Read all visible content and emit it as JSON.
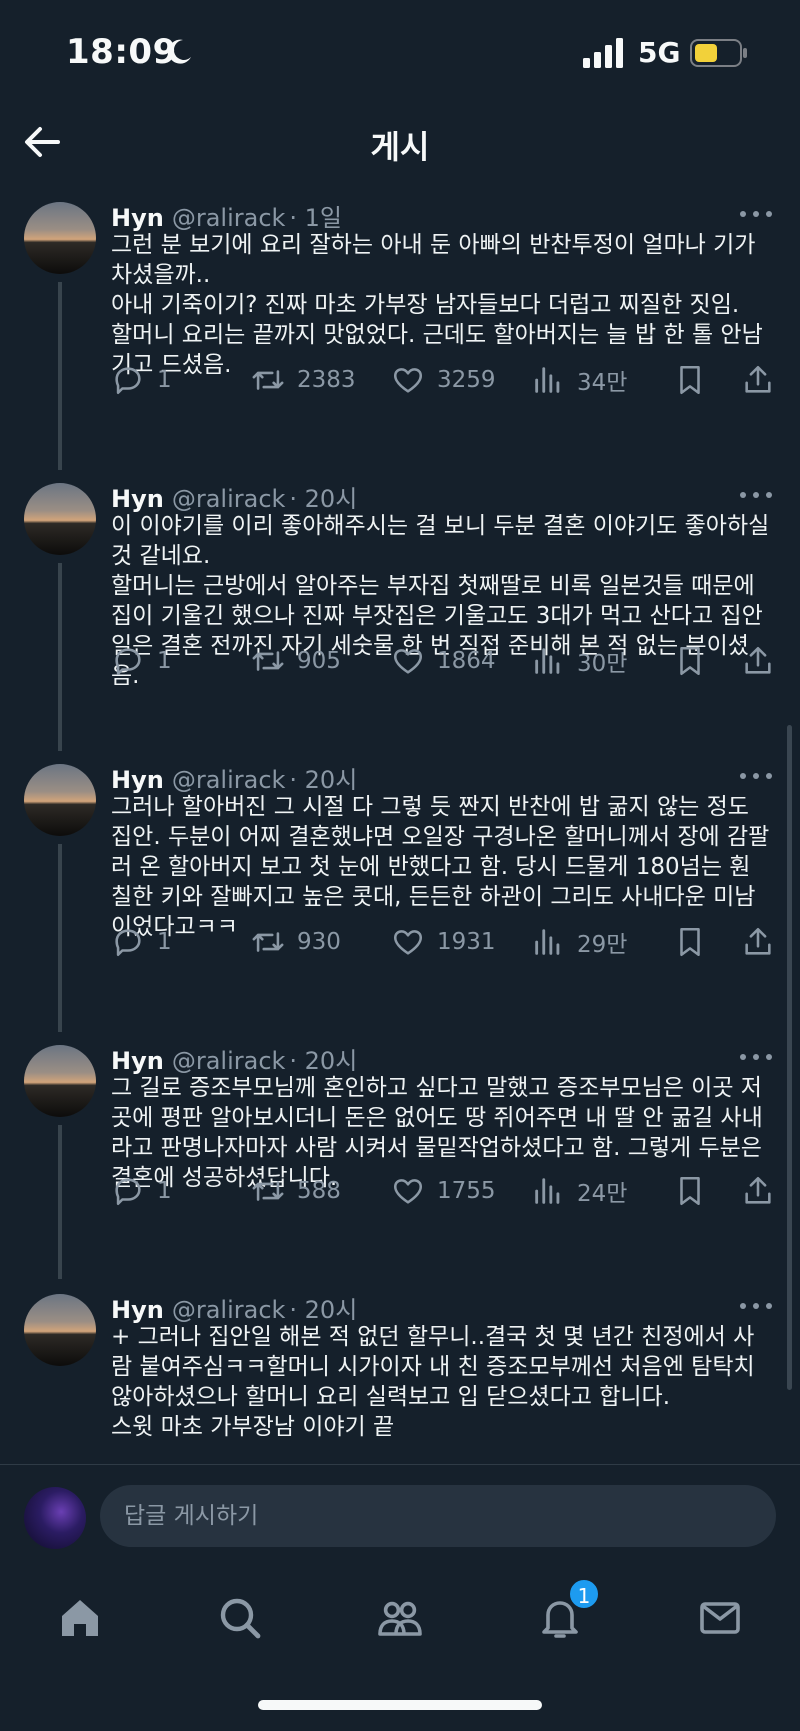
{
  "status_bar": {
    "time": "18:09",
    "network": "5G"
  },
  "header": {
    "title": "게시"
  },
  "tweets": [
    {
      "author": "Hyn",
      "handle": "@ralirack",
      "time": "· 1일",
      "text": "그런 분 보기에 요리 잘하는 아내 둔 아빠의 반찬투정이 얼마나 기가 차셨을까..\n아내 기죽이기? 진짜 마초 가부장 남자들보다 더럽고 찌질한 짓임.\n할머니 요리는 끝까지 맛없었다. 근데도 할아버지는 늘 밥 한 톨 안남기고 드셨음.",
      "replies": "1",
      "retweets": "2383",
      "likes": "3259",
      "views": "34만"
    },
    {
      "author": "Hyn",
      "handle": "@ralirack",
      "time": "· 20시",
      "text": "이 이야기를 이리 좋아해주시는 걸 보니 두분 결혼 이야기도 좋아하실 것 같네요.\n할머니는 근방에서 알아주는 부자집 첫째딸로 비록 일본것들 때문에 집이 기울긴 했으나 진짜 부잣집은 기울고도 3대가 먹고 산다고 집안일은 결혼 전까진 자기 세숫물 한 번 직접 준비해 본 적 없는 분이셨음.",
      "replies": "1",
      "retweets": "905",
      "likes": "1864",
      "views": "30만"
    },
    {
      "author": "Hyn",
      "handle": "@ralirack",
      "time": "· 20시",
      "text": "그러나 할아버진 그 시절 다 그렇 듯 짠지 반찬에 밥 굶지 않는 정도 집안. 두분이 어찌 결혼했냐면 오일장 구경나온 할머니께서 장에 감팔러 온 할아버지 보고 첫 눈에 반했다고 함. 당시 드물게 180넘는 훤칠한 키와 잘빠지고 높은 콧대, 든든한 하관이 그리도 사내다운 미남이었다고ㅋㅋ",
      "replies": "1",
      "retweets": "930",
      "likes": "1931",
      "views": "29만"
    },
    {
      "author": "Hyn",
      "handle": "@ralirack",
      "time": "· 20시",
      "text": "그 길로 증조부모님께 혼인하고 싶다고 말했고 증조부모님은 이곳 저곳에 평판 알아보시더니 돈은 없어도 땅 쥐어주면 내 딸 안 굶길 사내라고 판명나자마자 사람 시켜서 물밑작업하셨다고 함. 그렇게 두분은 결혼에 성공하셨답니다.",
      "replies": "1",
      "retweets": "588",
      "likes": "1755",
      "views": "24만"
    },
    {
      "author": "Hyn",
      "handle": "@ralirack",
      "time": "· 20시",
      "text": "+ 그러나 집안일 해본 적 없던 할무니..결국 첫 몇 년간 친정에서 사람 붙여주심ㅋㅋ할머니 시가이자 내 친 증조모부께선 처음엔 탐탁치 않아하셨으나 할머니 요리 실력보고 입 닫으셨다고 합니다.\n스윗 마초 가부장남 이야기 끝"
    }
  ],
  "reply_bar": {
    "placeholder": "답글 게시하기"
  },
  "tab_bar": {
    "notification_count": "1"
  },
  "colors": {
    "background": "#15202b",
    "text": "#f7f9f9",
    "muted": "#8b98a5",
    "accent": "#1d9bf0",
    "battery": "#f2d13a"
  },
  "icons": [
    "moon-icon",
    "signal-icon",
    "battery-icon",
    "back-arrow-icon",
    "more-icon",
    "reply-icon",
    "retweet-icon",
    "like-icon",
    "views-icon",
    "bookmark-icon",
    "share-icon",
    "home-icon",
    "search-icon",
    "communities-icon",
    "notifications-icon",
    "messages-icon"
  ]
}
